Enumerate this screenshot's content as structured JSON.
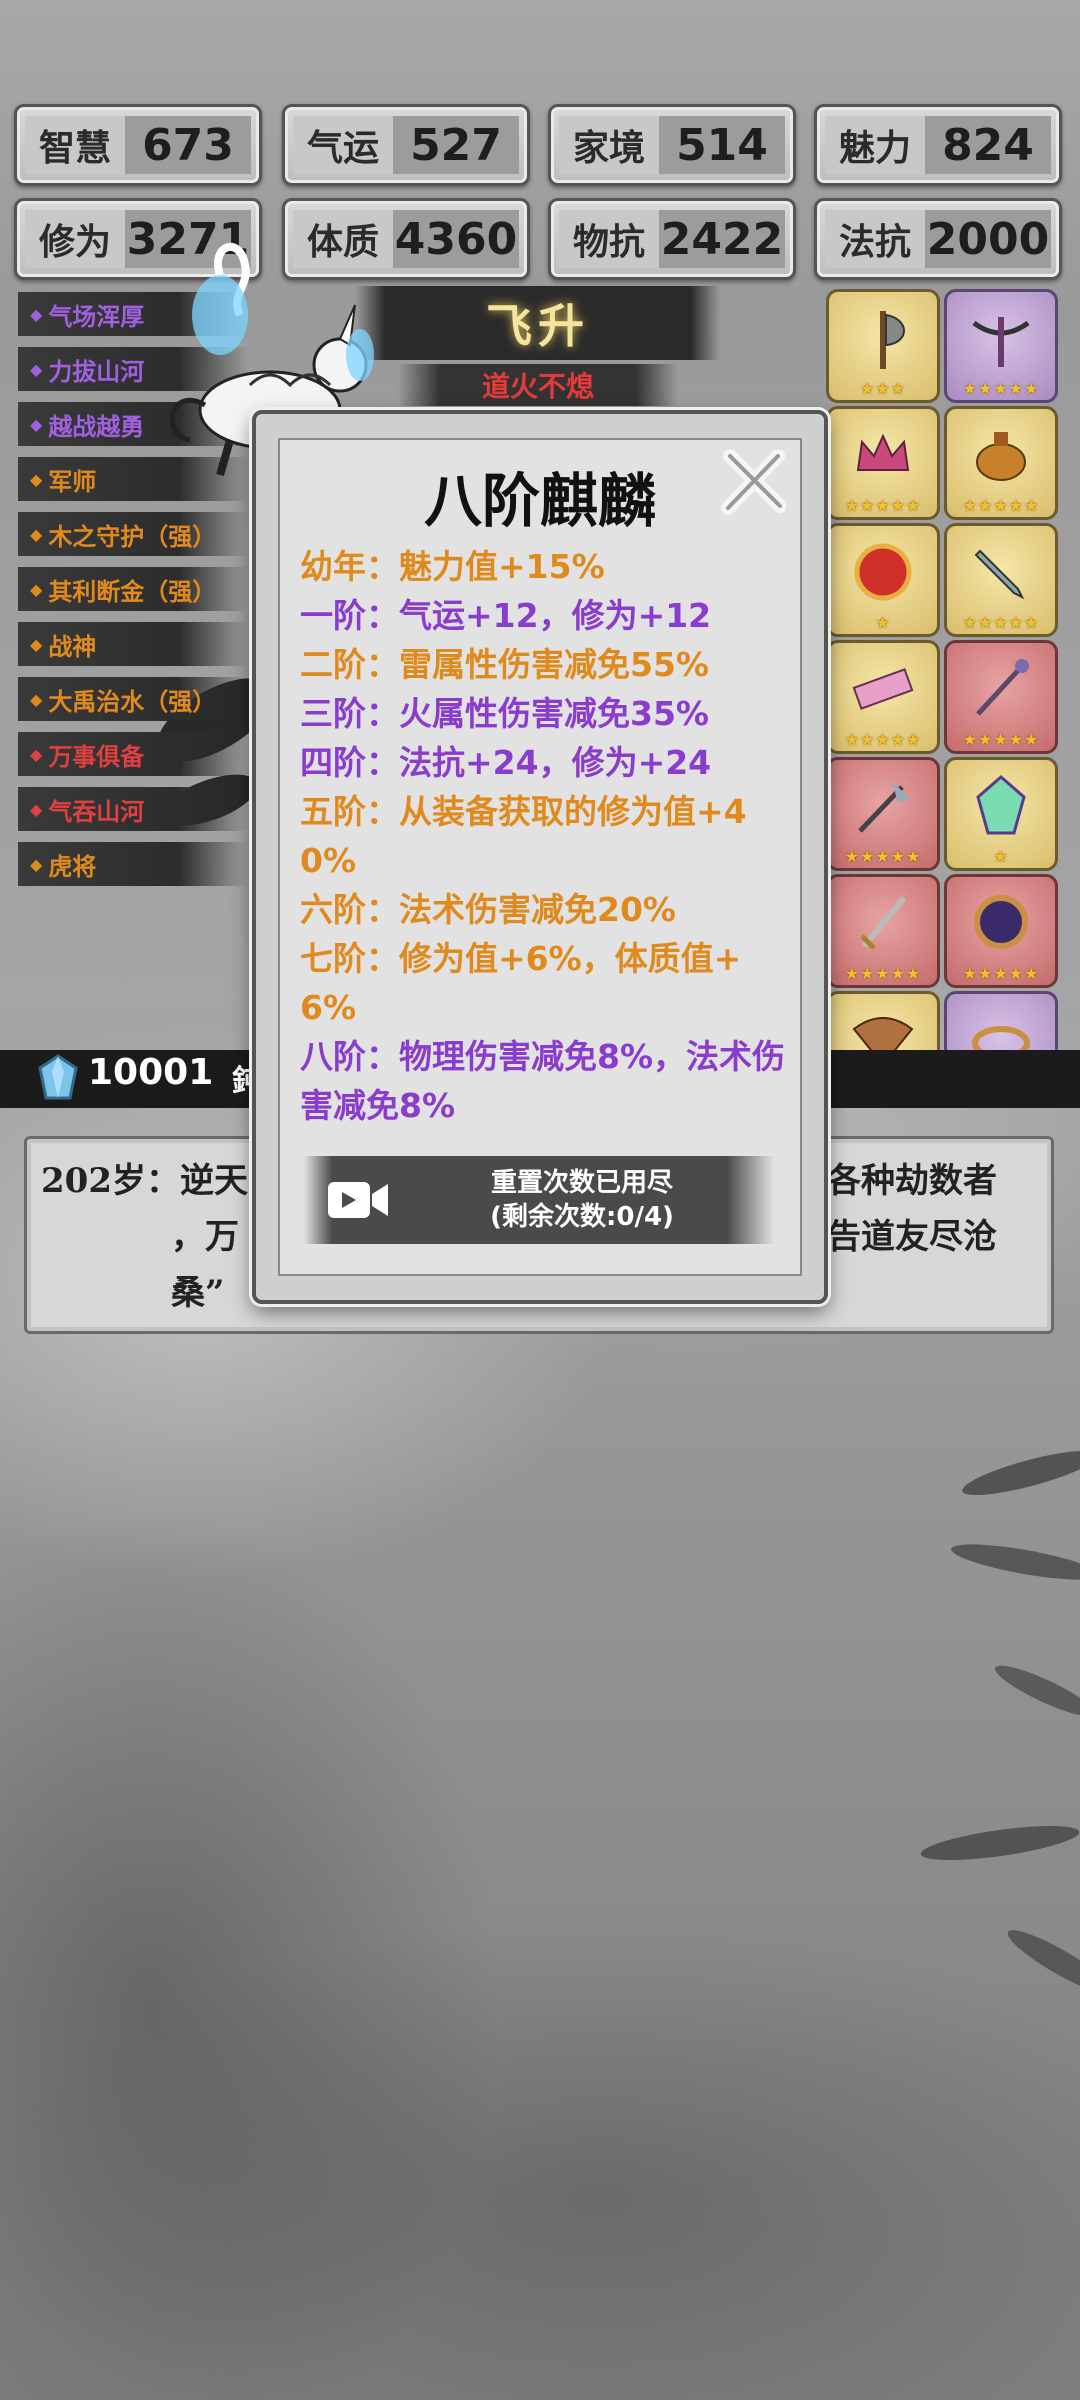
{
  "stats": [
    {
      "label": "智慧",
      "value": "673"
    },
    {
      "label": "气运",
      "value": "527"
    },
    {
      "label": "家境",
      "value": "514"
    },
    {
      "label": "魅力",
      "value": "824"
    },
    {
      "label": "修为",
      "value": "3271"
    },
    {
      "label": "体质",
      "value": "4360"
    },
    {
      "label": "物抗",
      "value": "2422"
    },
    {
      "label": "法抗",
      "value": "2000"
    }
  ],
  "skills": [
    {
      "label": "气场浑厚",
      "color": "#a060e0"
    },
    {
      "label": "力拔山河",
      "color": "#a060e0"
    },
    {
      "label": "越战越勇",
      "color": "#a060e0"
    },
    {
      "label": "军师",
      "color": "#e08a1e"
    },
    {
      "label": "木之守护（强）",
      "color": "#e08a1e"
    },
    {
      "label": "其利断金（强）",
      "color": "#e08a1e"
    },
    {
      "label": "战神",
      "color": "#e08a1e"
    },
    {
      "label": "大禹治水（强）",
      "color": "#e08a1e"
    },
    {
      "label": "万事俱备",
      "color": "#e04040"
    },
    {
      "label": "气吞山河",
      "color": "#e04040"
    },
    {
      "label": "虎将",
      "color": "#e08a1e"
    }
  ],
  "ascension": {
    "title": "飞升",
    "subtitle": "道火不熄"
  },
  "equipment": [
    {
      "icon": "axe-icon",
      "frame": "gold",
      "stars": "★★★"
    },
    {
      "icon": "crossbow-icon",
      "frame": "purple",
      "stars": "★★★★★"
    },
    {
      "icon": "crown-icon",
      "frame": "gold",
      "stars": "★★★★★"
    },
    {
      "icon": "incense-burner-icon",
      "frame": "gold",
      "stars": "★★★★★"
    },
    {
      "icon": "red-orb-icon",
      "frame": "gold",
      "stars": "★"
    },
    {
      "icon": "dagger-icon",
      "frame": "gold",
      "stars": "★★★★★"
    },
    {
      "icon": "scroll-icon",
      "frame": "gold",
      "stars": "★★★★★"
    },
    {
      "icon": "staff-icon",
      "frame": "red",
      "stars": "★★★★★"
    },
    {
      "icon": "halberd-icon",
      "frame": "red",
      "stars": "★★★★★"
    },
    {
      "icon": "crystal-icon",
      "frame": "gold",
      "stars": "★"
    },
    {
      "icon": "sword-icon",
      "frame": "red",
      "stars": "★★★★★"
    },
    {
      "icon": "mirror-icon",
      "frame": "red",
      "stars": "★★★★★"
    },
    {
      "icon": "fan-icon",
      "frame": "gold",
      "stars": "★★★"
    },
    {
      "icon": "ring-icon",
      "frame": "purple",
      "stars": "★"
    }
  ],
  "modal": {
    "title": "八阶麒麟",
    "lines": [
      {
        "text": "幼年：魅力值+15%",
        "color": "orange"
      },
      {
        "text": "一阶：气运+12，修为+12",
        "color": "purple"
      },
      {
        "text": "二阶：雷属性伤害减免55%",
        "color": "orange"
      },
      {
        "text": "三阶：火属性伤害减免35%",
        "color": "purple"
      },
      {
        "text": "四阶：法抗+24，修为+24",
        "color": "purple"
      },
      {
        "text": "五阶：从装备获取的修为值+40%",
        "color": "orange"
      },
      {
        "text": "六阶：法术伤害减免20%",
        "color": "orange"
      },
      {
        "text": "七阶：修为值+6%，体质值+6%",
        "color": "orange"
      },
      {
        "text": "八阶：物理伤害减免8%，法术伤害减免8%",
        "color": "purple"
      }
    ],
    "reset_line1": "重置次数已用尽",
    "reset_line2": "(剩余次数:0/4)"
  },
  "currency": {
    "value": "10001",
    "side": "鈍"
  },
  "log": {
    "age": "202岁：逆天",
    "line2_left": "，万",
    "line3_left": "桑”",
    "right1": "各种劫数者",
    "right2": "告道友尽沧"
  }
}
